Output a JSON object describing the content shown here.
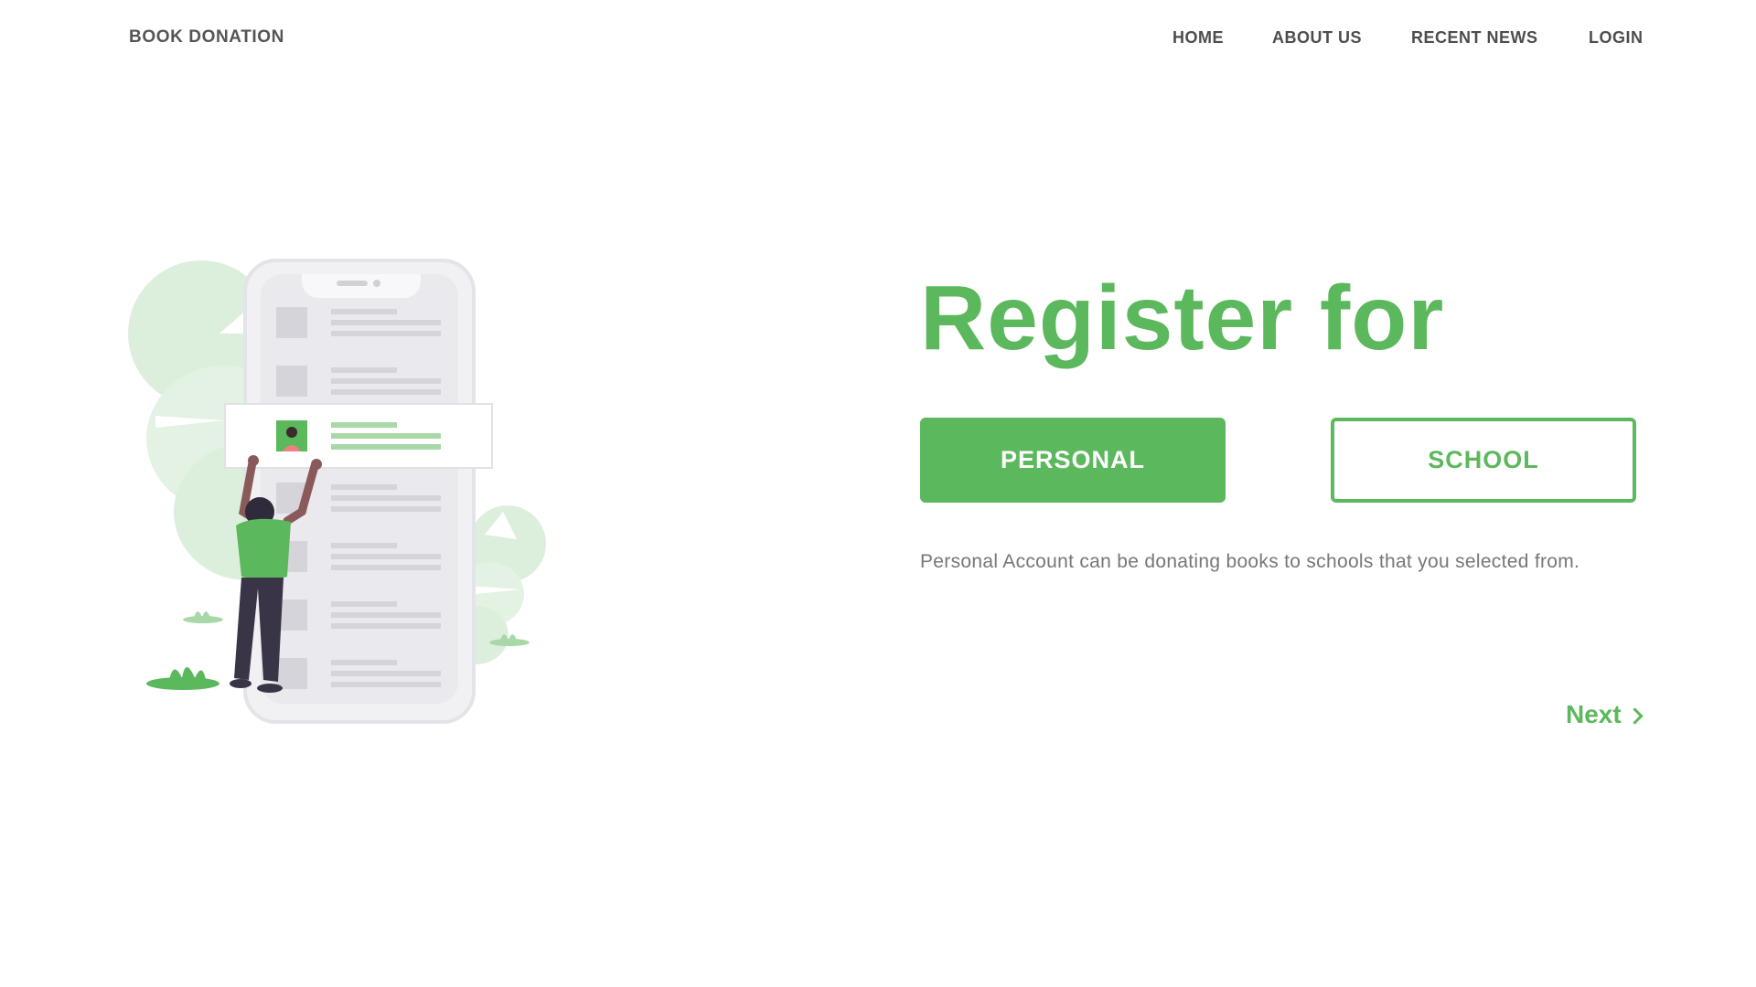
{
  "header": {
    "brand": "BOOK DONATION",
    "nav": [
      {
        "label": "HOME"
      },
      {
        "label": "ABOUT US"
      },
      {
        "label": "RECENT NEWS"
      },
      {
        "label": "LOGIN"
      }
    ]
  },
  "main": {
    "title": "Register for",
    "options": {
      "personal_label": "PERSONAL",
      "school_label": "SCHOOL",
      "selected": "PERSONAL"
    },
    "description": "Personal Account can be donating books to schools that you selected from.",
    "next_label": "Next"
  },
  "colors": {
    "accent": "#5cb85c",
    "text_dark": "#4d4d4d",
    "text_muted": "#777777",
    "leaf_light": "#dcefdc"
  },
  "icons": {
    "illustration": "person-reaching-phone-list-illustration",
    "next": "chevron-right-icon"
  }
}
